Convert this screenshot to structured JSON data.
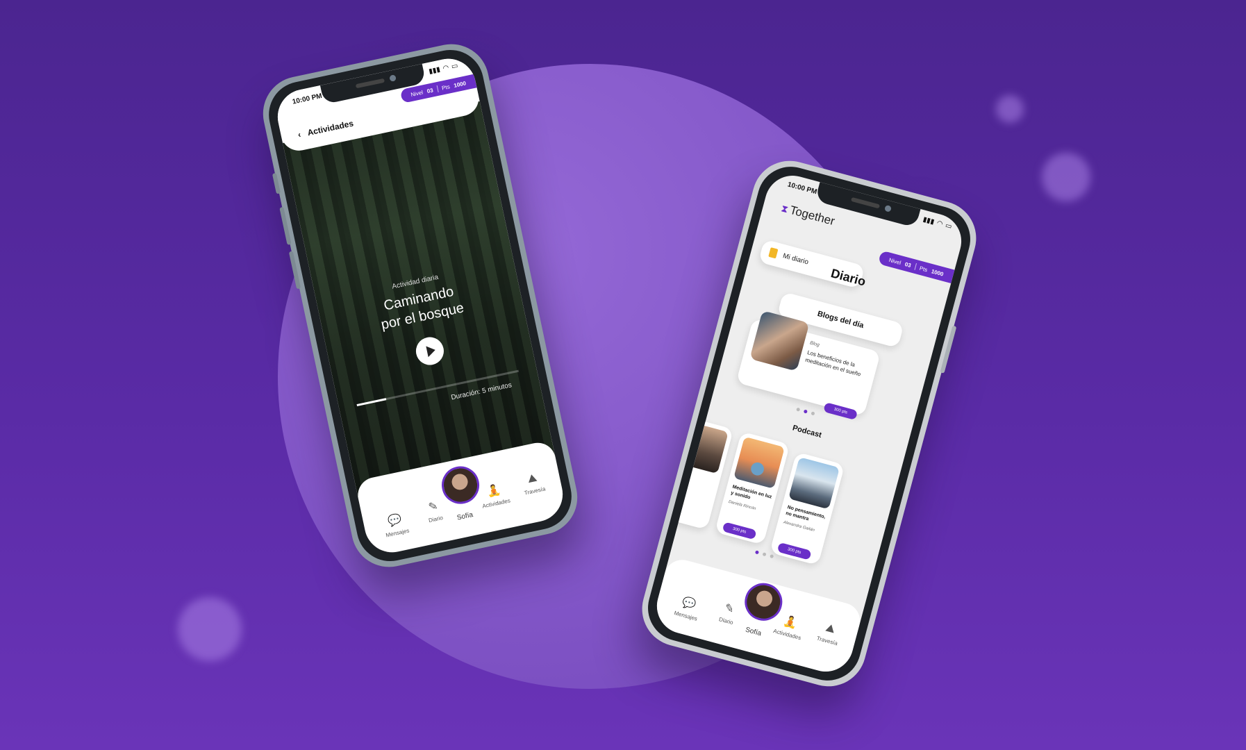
{
  "colors": {
    "accent": "#6a2fc8",
    "background": "#5a2ba6"
  },
  "status": {
    "time": "10:00 PM"
  },
  "level_pill": {
    "level_label": "Nivel",
    "level_value": "03",
    "points_label": "Pts",
    "points_value": "1000"
  },
  "activity_screen": {
    "back_icon": "chevron-left-icon",
    "title": "Actividades",
    "daily_label": "Actividad diaria",
    "activity_title_line1": "Caminando",
    "activity_title_line2": "por el bosque",
    "progress": 0.18,
    "duration": "Duración: 5 minutos"
  },
  "nav": {
    "tabs": [
      {
        "label": "Mensajes",
        "icon": "chat-icon"
      },
      {
        "label": "Diario",
        "icon": "edit-icon"
      },
      {
        "label": "Actividades",
        "icon": "meditation-icon"
      },
      {
        "label": "Travesía",
        "icon": "journey-icon"
      }
    ],
    "user_name": "Sofía"
  },
  "diary_screen": {
    "app_name": "Together",
    "title": "Diario",
    "my_diary": "Mi diario",
    "blogs_title": "Blogs del día",
    "blog": {
      "tag": "Blog",
      "title": "Los beneficios de la meditación en el sueño",
      "points": "300 pts"
    },
    "podcast_title": "Podcast",
    "podcasts": [
      {
        "title": "Meditación en luz y sonido",
        "author": "Daniela Rincón",
        "points": "300 pts"
      },
      {
        "title": "No pensamiento, no mantra",
        "author": "Alexandra Gaitán",
        "points": "300 pts"
      }
    ]
  }
}
